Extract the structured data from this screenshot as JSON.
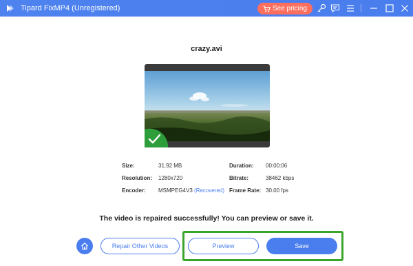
{
  "window": {
    "title": "Tipard FixMP4 (Unregistered)",
    "pricing_label": "See pricing",
    "icons": [
      "cart-icon",
      "key-icon",
      "feedback-icon",
      "menu-icon",
      "minimize-icon",
      "maximize-icon",
      "close-icon"
    ]
  },
  "file": {
    "name": "crazy.avi"
  },
  "info": {
    "size_label": "Size:",
    "size_value": "31.92 MB",
    "resolution_label": "Resolution:",
    "resolution_value": "1280x720",
    "encoder_label": "Encoder:",
    "encoder_value": "MSMPEG4V3",
    "encoder_status": "(Recovered)",
    "duration_label": "Duration:",
    "duration_value": "00:00:06",
    "bitrate_label": "Bitrate:",
    "bitrate_value": "38462 kbps",
    "framerate_label": "Frame Rate:",
    "framerate_value": "30.00 fps"
  },
  "message": "The video is repaired successfully! You can preview or save it.",
  "actions": {
    "repair_other": "Repair Other Videos",
    "preview": "Preview",
    "save": "Save"
  },
  "colors": {
    "accent": "#4a7ded",
    "pricing": "#ff6f5e",
    "highlight": "#3aa52b",
    "success": "#2e9e3a"
  }
}
